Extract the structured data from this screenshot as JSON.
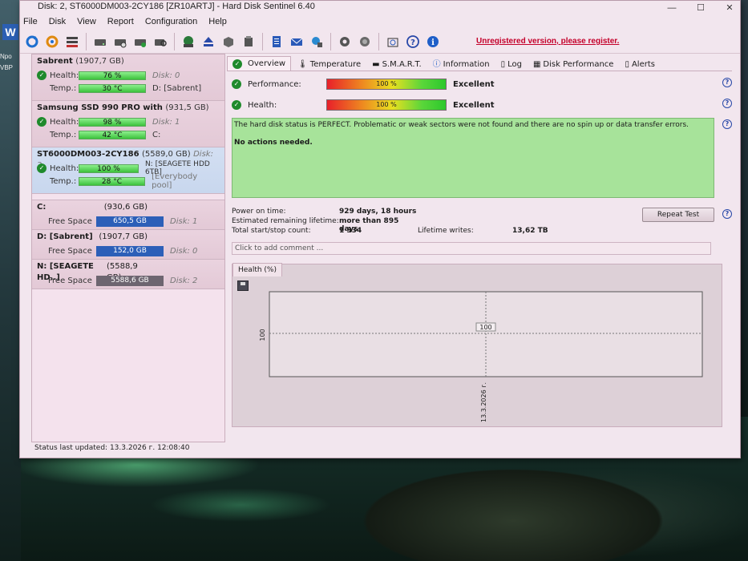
{
  "window": {
    "title": "Disk: 2, ST6000DM003-2CY186 [ZR10ARTJ]  -  Hard Disk Sentinel 6.40",
    "min": "—",
    "max": "☐",
    "close": "✕"
  },
  "desktop": {
    "word_icon": "W",
    "text1": "Npo",
    "text2": "VBP"
  },
  "menu": [
    "File",
    "Disk",
    "View",
    "Report",
    "Configuration",
    "Help"
  ],
  "register_link": "Unregistered version, please register.",
  "disks": [
    {
      "name": "Sabrent",
      "size": "(1907,7 GB)",
      "health_label": "Health:",
      "health": "76 %",
      "health_level": 76,
      "temp_label": "Temp.:",
      "temp": "30 °C",
      "disk_tag": "Disk: 0",
      "drive_tag": "D: [Sabrent]",
      "selected": false
    },
    {
      "name": "Samsung SSD 990 PRO with",
      "size": "(931,5 GB)",
      "health_label": "Health:",
      "health": "98 %",
      "health_level": 98,
      "temp_label": "Temp.:",
      "temp": "42 °C",
      "disk_tag": "Disk: 1",
      "drive_tag": "C:",
      "selected": false
    },
    {
      "name": "ST6000DM003-2CY186",
      "size": "(5589,0 GB)",
      "disk_short": "Disk: 2",
      "health_label": "Health:",
      "health": "100 %",
      "health_level": 100,
      "temp_label": "Temp.:",
      "temp": "28 °C",
      "disk_tag": "N: [SEAGETE HDD  6TB]",
      "drive_tag": "[Everybody pool]",
      "selected": true
    }
  ],
  "volumes": [
    {
      "name": "C:",
      "size": "(930,6 GB)",
      "free_label": "Free Space",
      "free": "650,5 GB",
      "disk": "Disk: 1"
    },
    {
      "name": "D: [Sabrent]",
      "size": "(1907,7 GB)",
      "free_label": "Free Space",
      "free": "152,0 GB",
      "disk": "Disk: 0"
    },
    {
      "name": "N: [SEAGETE HD..]",
      "size": "(5588,9 GB)",
      "free_label": "Free Space",
      "free": "5588,6 GB",
      "disk": "Disk: 2"
    }
  ],
  "status_line": "Status last updated: 13.3.2026 г. 12:08:40",
  "tabs": [
    "Overview",
    "Temperature",
    "S.M.A.R.T.",
    "Information",
    "Log",
    "Disk Performance",
    "Alerts"
  ],
  "performance": {
    "label": "Performance:",
    "value": "100 %",
    "level": 100,
    "rating": "Excellent"
  },
  "health": {
    "label": "Health:",
    "value": "100 %",
    "level": 100,
    "rating": "Excellent"
  },
  "status_message": "The hard disk status is PERFECT. Problematic or weak sectors were not found and there are no spin up or data transfer errors.",
  "status_action": "No actions needed.",
  "info": {
    "power_on_label": "Power on time:",
    "power_on": "929 days, 18 hours",
    "remaining_label": "Estimated remaining lifetime:",
    "remaining": "more than 895 days",
    "startstop_label": "Total start/stop count:",
    "startstop": "1 334",
    "writes_label": "Lifetime writes:",
    "writes": "13,62 TB"
  },
  "repeat_test": "Repeat Test",
  "comment_placeholder": "Click to add comment ...",
  "graph_tab": "Health (%)",
  "help": "?",
  "chart_data": {
    "type": "line",
    "x": [
      "13.3.2026 г."
    ],
    "series": [
      {
        "values": [
          100
        ]
      }
    ],
    "ylabel": "100",
    "point_label": "100",
    "grid": true
  }
}
